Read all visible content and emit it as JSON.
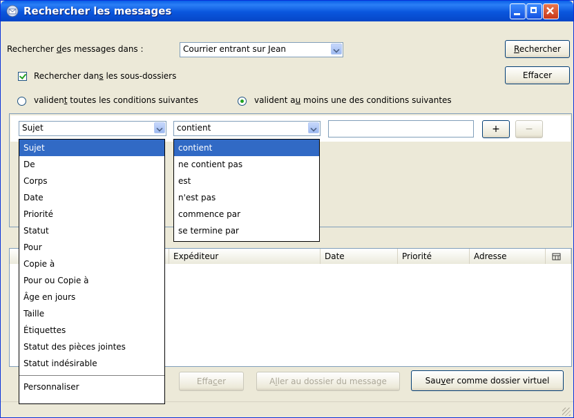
{
  "window": {
    "title": "Rechercher les messages",
    "buttons": [
      "minimize",
      "maximize",
      "close"
    ]
  },
  "search_in": {
    "label_pre": "Rechercher ",
    "label_ul": "d",
    "label_post": "es messages dans :",
    "folder": "Courrier entrant sur Jean"
  },
  "actions": {
    "search_pre": "",
    "search_ul": "R",
    "search_post": "echercher",
    "clear_pre": "Ef",
    "clear_ul": "f",
    "clear_post": "acer"
  },
  "subfolders": {
    "label_pre": "Rechercher dan",
    "label_ul": "s",
    "label_post": " les sous-dossiers",
    "checked": true
  },
  "match": {
    "all_pre": "validen",
    "all_ul": "t",
    "all_post": " toutes les conditions suivantes",
    "any_pre": "validen",
    "any_mid": "t a",
    "any_ul": "u",
    "any_post": " moins une des conditions suivantes",
    "selected": "any"
  },
  "criteria": {
    "field": "Sujet",
    "operator": "contient",
    "value": "",
    "add_label": "+",
    "remove_label": "−"
  },
  "field_options": [
    "Sujet",
    "De",
    "Corps",
    "Date",
    "Priorité",
    "Statut",
    "Pour",
    "Copie à",
    "Pour ou Copie à",
    "Âge en jours",
    "Taille",
    "Étiquettes",
    "Statut des pièces jointes",
    "Statut indésirable"
  ],
  "field_extra": "Personnaliser",
  "operator_options": [
    "contient",
    "ne contient pas",
    "est",
    "n'est pas",
    "commence par",
    "se termine par"
  ],
  "results": {
    "columns": [
      "Expéditeur",
      "Date",
      "Priorité",
      "Adresse"
    ]
  },
  "bottom": {
    "clear_pre": "Effa",
    "clear_ul": "c",
    "clear_post": "er",
    "goto_pre": "A",
    "goto_ul": "l",
    "goto_post": "ler au dossier du message",
    "save_pre": "Sau",
    "save_ul": "v",
    "save_post": "er comme dossier virtuel"
  }
}
